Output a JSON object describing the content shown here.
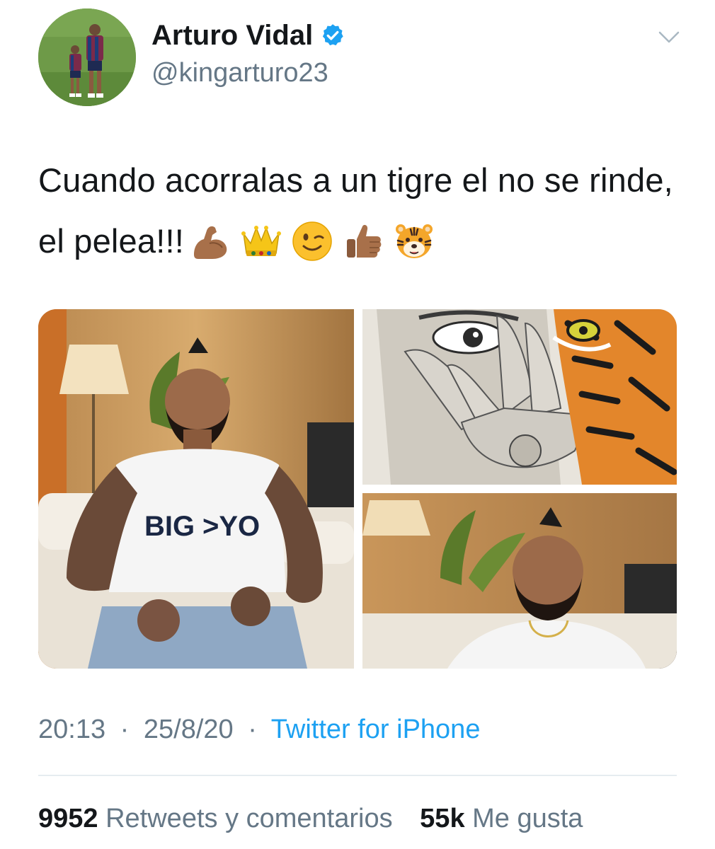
{
  "user": {
    "display_name": "Arturo Vidal",
    "handle": "@kingarturo23",
    "verified": true
  },
  "tweet": {
    "text": "Cuando acorralas a un tigre el no se rinde, el pelea!!!",
    "emojis": [
      "flexed-biceps",
      "crown",
      "winking-face",
      "thumbs-up",
      "tiger-face"
    ]
  },
  "meta": {
    "time": "20:13",
    "date": "25/8/20",
    "separator": "·",
    "source": "Twitter for iPhone"
  },
  "stats": {
    "retweets_count": "9952",
    "retweets_label": "Retweets y comentarios",
    "likes_count": "55k",
    "likes_label": "Me gusta"
  },
  "colors": {
    "text": "#14171a",
    "secondary": "#657786",
    "link": "#1da1f2",
    "verified": "#1da1f2",
    "divider": "#e6ecf0"
  },
  "icons": [
    "verified-badge-icon",
    "chevron-down-icon"
  ]
}
